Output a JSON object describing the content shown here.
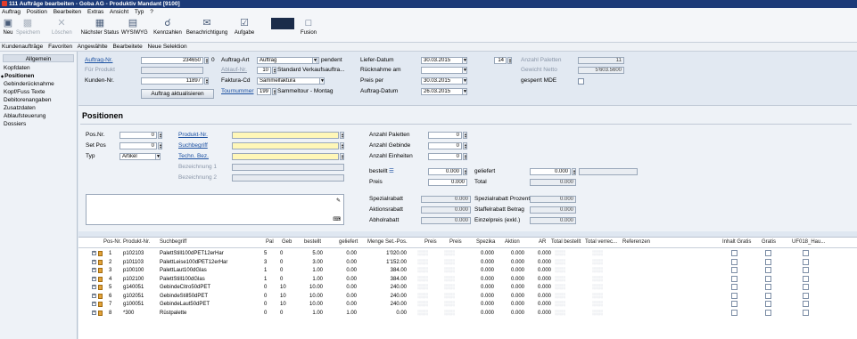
{
  "window": {
    "title": "111 Aufträge bearbeiten - Goba AG - Produktiv Mandant [9100]"
  },
  "menu": [
    "Auftrag",
    "Position",
    "Bearbeiten",
    "Extras",
    "Ansicht",
    "Typ",
    "?"
  ],
  "toolbar": {
    "neu": "Neu",
    "speichern": "Speichern",
    "loeschen": "Löschen",
    "naechster_status": "Nächster Status",
    "wysiwyg": "WYSIWYG",
    "kennzahlen": "Kennzahlen",
    "benachrichtigung": "Benachrichtigung",
    "aufgabe": "Aufgabe",
    "fusion": "Fusion"
  },
  "nav": [
    "Kundenaufträge",
    "Favoriten",
    "Angewählte",
    "Bearbeitete",
    "Neue Selektion"
  ],
  "sidebar": {
    "header": "Allgemein",
    "items": [
      "Kopfdaten",
      "Positionen",
      "Gebinderücknahme",
      "Kopf/Fuss Texte",
      "Debitorenangaben",
      "Zusatzdaten",
      "Ablaufsteuerung",
      "Dossiers"
    ]
  },
  "header": {
    "auftrag_nr_label": "Auftrag-Nr.",
    "auftrag_nr": "234650",
    "auftrag_suffix": "0",
    "fuerprodukt_label": "Für Produkt",
    "fuerprodukt_value": "",
    "kunden_nr_label": "Kunden-Nr.",
    "kunden_nr": "11897",
    "aktualisieren_btn": "Auftrag aktualisieren",
    "auftrag_art_label": "Auftrag-Art",
    "auftrag_art": "Auftrag",
    "pendent": "pendent",
    "ablauf_nr_label": "Ablauf-Nr.",
    "ablauf_nr": "10",
    "ablauf_text": "Standard Verkaufsauftra...",
    "faktura_cd_label": "Faktura-Cd",
    "faktura_cd": "Sammelfaktura",
    "tournummer_label": "Tournummer",
    "tournummer": "199",
    "tour_text": "Sammeltour - Montag",
    "liefer_datum_label": "Liefer-Datum",
    "liefer_datum": "30.03.2015",
    "kw": "14",
    "rueckname_label": "Rücknahme am",
    "rueckname": "",
    "preis_per_label": "Preis per",
    "preis_per": "30.03.2015",
    "auftrag_datum_label": "Auftrag-Datum",
    "auftrag_datum": "26.03.2015",
    "anzahl_paletten_label": "Anzahl Paletten",
    "anzahl_paletten": "11",
    "gewicht_label": "Gewicht Netto",
    "gewicht": "5'603.5600",
    "gesperrt_label": "gesperrt MDE"
  },
  "positions": {
    "title": "Positionen",
    "pos_nr_label": "Pos.Nr.",
    "pos_nr": "0",
    "set_pos_label": "Set Pos",
    "set_pos": "0",
    "typ_label": "Typ",
    "typ": "Artikel",
    "produkt_nr_label": "Produkt-Nr.",
    "suchbegriff_label": "Suchbegriff",
    "techn_bez_label": "Techn. Bez.",
    "bez1_label": "Bezeichnung 1",
    "bez2_label": "Bezeichnung 2",
    "anzahl_paletten_label": "Anzahl Paletten",
    "anzahl_paletten": "0",
    "anzahl_gebinde_label": "Anzahl Gebinde",
    "anzahl_gebinde": "0",
    "anzahl_einheiten_label": "Anzahl Einheiten",
    "anzahl_einheiten": "0",
    "bestellt_label": "bestellt",
    "bestellt": "0.000",
    "geliefert_label": "geliefert",
    "geliefert": "0.000",
    "preis_label": "Preis",
    "preis": "0.000",
    "total_label": "Total",
    "total": "0.000",
    "spezialrabatt_label": "Spezialrabatt",
    "spezialrabatt": "0.000",
    "spezialrabatt_prozent_label": "Spezialrabatt Prozent",
    "spezialrabatt_prozent": "0.000",
    "aktionsrabatt_label": "Aktionsrabatt",
    "aktionsrabatt": "0.000",
    "staffelrabatt_label": "Staffelrabatt Betrag",
    "staffelrabatt": "0.000",
    "abholrabatt_label": "Abholrabatt",
    "abholrabatt": "0.000",
    "einzelpreis_label": "Einzelpreis (exkl.)",
    "einzelpreis": "0.000"
  },
  "table": {
    "columns": [
      "Pos-Nr.",
      "Produkt-Nr.",
      "Suchbegriff",
      "Pal",
      "Geb",
      "bestellt",
      "geliefert",
      "Menge Set.-Pos.",
      "Preis",
      "Preis",
      "Spezika",
      "Aktion",
      "AR",
      "Total bestellt",
      "Total verrec...",
      "Referenzen",
      "Inhalt Gratis",
      "Gratis",
      "UF018_Hau..."
    ],
    "rows": [
      {
        "pos": "1",
        "produkt": "p102103",
        "such": "PalettStill100dPET12erHar",
        "pal": "5",
        "geb": "0",
        "bestellt": "5.00",
        "geliefert": "0.00",
        "menge": "1'020.00",
        "spezika": "0.000",
        "aktion": "0.000",
        "ar": "0.000"
      },
      {
        "pos": "2",
        "produkt": "p101103",
        "such": "PalettLeise100dPET12erHar",
        "pal": "3",
        "geb": "0",
        "bestellt": "3.00",
        "geliefert": "0.00",
        "menge": "1'152.00",
        "spezika": "0.000",
        "aktion": "0.000",
        "ar": "0.000"
      },
      {
        "pos": "3",
        "produkt": "p100100",
        "such": "PalettLaut100dGlas",
        "pal": "1",
        "geb": "0",
        "bestellt": "1.00",
        "geliefert": "0.00",
        "menge": "384.00",
        "spezika": "0.000",
        "aktion": "0.000",
        "ar": "0.000"
      },
      {
        "pos": "4",
        "produkt": "p102100",
        "such": "PalettStill100dGlas",
        "pal": "1",
        "geb": "0",
        "bestellt": "1.00",
        "geliefert": "0.00",
        "menge": "384.00",
        "spezika": "0.000",
        "aktion": "0.000",
        "ar": "0.000"
      },
      {
        "pos": "5",
        "produkt": "g140051",
        "such": "GebindeCitro50dPET",
        "pal": "0",
        "geb": "10",
        "bestellt": "10.00",
        "geliefert": "0.00",
        "menge": "240.00",
        "spezika": "0.000",
        "aktion": "0.000",
        "ar": "0.000"
      },
      {
        "pos": "6",
        "produkt": "g102051",
        "such": "GebindeStill50dPET",
        "pal": "0",
        "geb": "10",
        "bestellt": "10.00",
        "geliefert": "0.00",
        "menge": "240.00",
        "spezika": "0.000",
        "aktion": "0.000",
        "ar": "0.000"
      },
      {
        "pos": "7",
        "produkt": "g100051",
        "such": "GebindeLaut50dPET",
        "pal": "0",
        "geb": "10",
        "bestellt": "10.00",
        "geliefert": "0.00",
        "menge": "240.00",
        "spezika": "0.000",
        "aktion": "0.000",
        "ar": "0.000"
      },
      {
        "pos": "8",
        "produkt": "*300",
        "such": "Rüstpalette",
        "pal": "0",
        "geb": "0",
        "bestellt": "1.00",
        "geliefert": "1.00",
        "menge": "0.00",
        "spezika": "0.000",
        "aktion": "0.000",
        "ar": "0.000"
      }
    ]
  },
  "colors": {
    "titlebar": "#1c3a78",
    "link": "#1a4fa0",
    "highlight": "#fff7b8"
  }
}
